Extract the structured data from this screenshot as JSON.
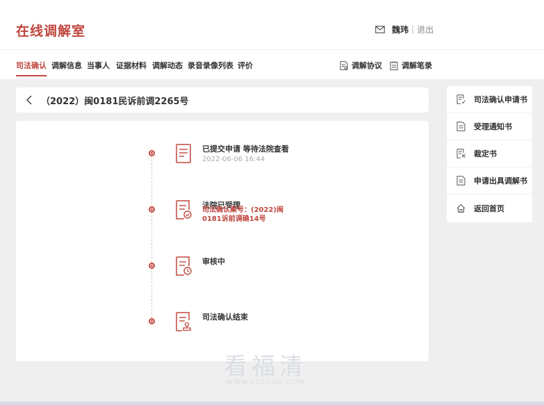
{
  "header": {
    "title": "在线调解室",
    "user_name": "魏玮",
    "separator": "|",
    "logout_label": "退出",
    "accent_color": "#c0463e"
  },
  "tabs": [
    {
      "label": "司法确认",
      "active": true
    },
    {
      "label": "调解信息",
      "active": false
    },
    {
      "label": "当事人",
      "active": false
    },
    {
      "label": "证据材料",
      "active": false
    },
    {
      "label": "调解动态",
      "active": false
    },
    {
      "label": "录音录像列表",
      "active": false
    },
    {
      "label": "评价",
      "active": false
    }
  ],
  "tools": {
    "agreement_label": "调解协议",
    "transcript_label": "调解笔录"
  },
  "case": {
    "title": "（2022）闽0181民诉前调2265号"
  },
  "timeline": {
    "steps": [
      {
        "title": "已提交申请 等待法院查看",
        "time": "2022-06-06 16:44",
        "icon": "document-icon"
      },
      {
        "title": "法院已受理",
        "case_label": "司法确认案号：",
        "case_number": "(2022)闽0181诉前调确14号",
        "icon": "document-check-icon"
      },
      {
        "title": "审核中",
        "icon": "document-clock-icon"
      },
      {
        "title": "司法确认结束",
        "icon": "document-stamp-icon"
      }
    ]
  },
  "side_menu": {
    "items": [
      {
        "label": "司法确认申请书",
        "icon": "document-edit-icon"
      },
      {
        "label": "受理通知书",
        "icon": "document-icon"
      },
      {
        "label": "裁定书",
        "icon": "document-check-icon"
      },
      {
        "label": "申请出具调解书",
        "icon": "document-icon"
      },
      {
        "label": "返回首页",
        "icon": "home-icon"
      }
    ]
  },
  "watermark": {
    "text": "看福清",
    "url": "WWW.FQLOOK.COM"
  }
}
